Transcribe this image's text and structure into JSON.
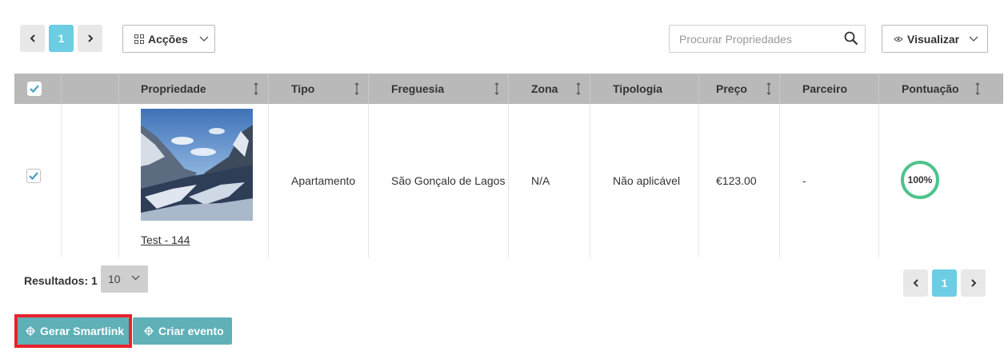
{
  "pagination_top": {
    "prev": "‹",
    "current": "1",
    "next": "›"
  },
  "actions": {
    "label": "Acções"
  },
  "search": {
    "placeholder": "Procurar Propriedades"
  },
  "view": {
    "label": "Visualizar"
  },
  "table": {
    "columns": [
      "Propriedade",
      "Tipo",
      "Freguesia",
      "Zona",
      "Tipologia",
      "Preço",
      "Parceiro",
      "Pontuação"
    ],
    "rows": [
      {
        "name": "Test - 144",
        "tipo": "Apartamento",
        "freguesia": "São Gonçalo de Lagos",
        "zona": "N/A",
        "tipologia": "Não aplicável",
        "preco": "€123.00",
        "parceiro": "-",
        "pontuacao": "100%",
        "pontuacao_value": 1.0,
        "checked": true
      }
    ]
  },
  "footer": {
    "results_label": "Resultados: 1",
    "per_page": "10"
  },
  "pagination_bottom": {
    "prev": "‹",
    "current": "1",
    "next": "›"
  },
  "buttons": {
    "smartlink": "Gerar Smartlink",
    "event": "Criar evento"
  },
  "colors": {
    "accent": "#6ccde3",
    "button": "#5fb0b7",
    "score_ring": "#4ec38a",
    "highlight": "#e8222c",
    "checkbox": "#4a9fc4"
  }
}
